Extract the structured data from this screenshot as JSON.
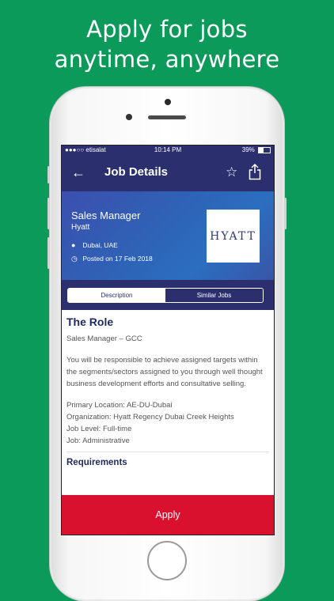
{
  "promo": {
    "line1": "Apply for jobs",
    "line2": "anytime, anywhere"
  },
  "status_bar": {
    "carrier": "●●●○○ etisalat",
    "time": "10:14 PM",
    "battery": "39%"
  },
  "nav": {
    "title": "Job Details"
  },
  "job": {
    "title": "Sales Manager",
    "company": "Hyatt",
    "location": "Dubai, UAE",
    "posted": "Posted on 17 Feb 2018",
    "logo_text": "HYATT"
  },
  "tabs": {
    "description": "Description",
    "similar": "Similar Jobs"
  },
  "content": {
    "section_title": "The Role",
    "subtitle": "Sales Manager – GCC",
    "description": "You will be responsible to achieve assigned targets within the segments/sectors assigned to you through well thought business development efforts and consultative selling.",
    "primary_location": "Primary Location: AE-DU-Dubai",
    "organization": "Organization: Hyatt Regency Dubai Creek Heights",
    "job_level": "Job Level: Full-time",
    "job": "Job: Administrative",
    "requirements_title": "Requirements"
  },
  "apply_label": "Apply",
  "colors": {
    "background": "#0c9a5a",
    "nav": "#2b2f6e",
    "apply": "#d9102e"
  }
}
